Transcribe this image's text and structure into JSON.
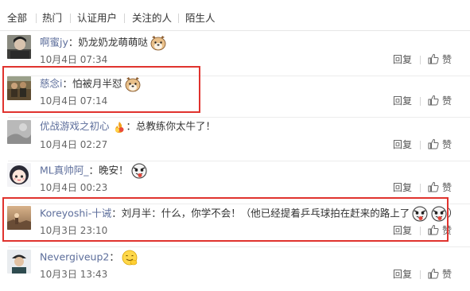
{
  "filter_tabs": [
    "全部",
    "热门",
    "认证用户",
    "关注的人",
    "陌生人"
  ],
  "reply_label": "回复",
  "like_label": "赞",
  "colors": {
    "username": "#5d6e9b",
    "highlight": "#e0332e",
    "divider": "#ececec"
  },
  "comments": [
    {
      "username": "啊蜜jy",
      "text": "奶龙奶龙萌萌哒",
      "emoticons": [
        "doge-emoji"
      ],
      "time": "10月4日 07:34",
      "avatar": "avatar-person-dark"
    },
    {
      "username": "慈念i",
      "text": "怕被月半怼",
      "emoticons": [
        "doge-emoji"
      ],
      "time": "10月4日 07:14",
      "avatar": "avatar-group-photo",
      "highlighted": true
    },
    {
      "username": "优战游戏之初心",
      "prefix_emoticon": "fire-badge-emoji",
      "text": "总教练你太牛了！",
      "emoticons": [],
      "time": "10月4日 02:27",
      "avatar": "avatar-gray-photo"
    },
    {
      "username": "ML真帅阿_",
      "text": "晚安！",
      "emoticons": [
        "tongue-face-emoji"
      ],
      "time": "10月4日 00:23",
      "avatar": "avatar-cartoon-girl"
    },
    {
      "username": "Koreyoshi-十诫",
      "text": "刘月半：什么，你学不会！（他已经提着乒乓球拍在赶来的路上了",
      "emoticons": [
        "tongue-face-emoji",
        "tongue-face-emoji"
      ],
      "suffix": "）",
      "time": "10月3日 23:10",
      "avatar": "avatar-sunset-photo",
      "highlighted": true
    },
    {
      "username": "Nevergiveup2",
      "text": "",
      "emoticons": [
        "smile-hand-emoji"
      ],
      "time": "10月3日 13:43",
      "avatar": "avatar-person-hat"
    }
  ]
}
